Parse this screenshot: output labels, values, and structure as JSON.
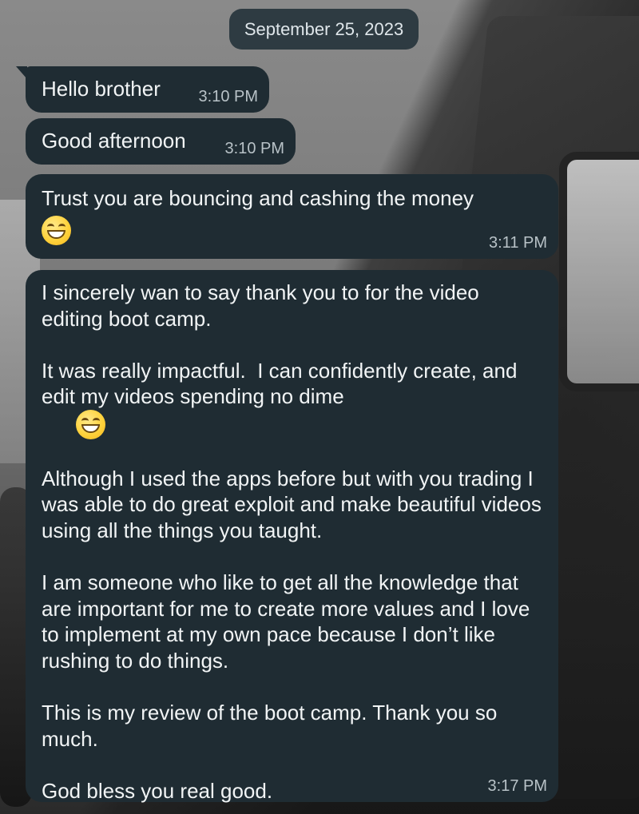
{
  "chat": {
    "date_label": "September 25, 2023",
    "messages": [
      {
        "text": "Hello brother",
        "time": "3:10 PM"
      },
      {
        "text": "Good afternoon",
        "time": "3:10 PM"
      },
      {
        "text": "Trust you are bouncing and cashing the money",
        "time": "3:11 PM",
        "emoji": "grinning-face-emoji"
      },
      {
        "time": "3:17 PM",
        "paragraphs": [
          "I sincerely wan to say thank you to for the video editing boot camp.",
          "It was really impactful.  I can confidently create, and edit my videos spending no dime",
          "Although I used the apps before but with you trading I was able to do great exploit and make beautiful videos using all the things you taught.",
          "I am someone who like to get all the knowledge that are important for me to create more values and I love to implement at my own pace because I don’t like rushing to do things.",
          "This is my review of the boot camp. Thank you so much.",
          "God bless you real good."
        ],
        "emoji": "grinning-face-emoji"
      }
    ]
  },
  "colors": {
    "bubble_bg": "#1f2c33",
    "bubble_text": "#f1f4f5",
    "time_text": "#b8c2c7",
    "date_chip_bg": "#26343c"
  }
}
